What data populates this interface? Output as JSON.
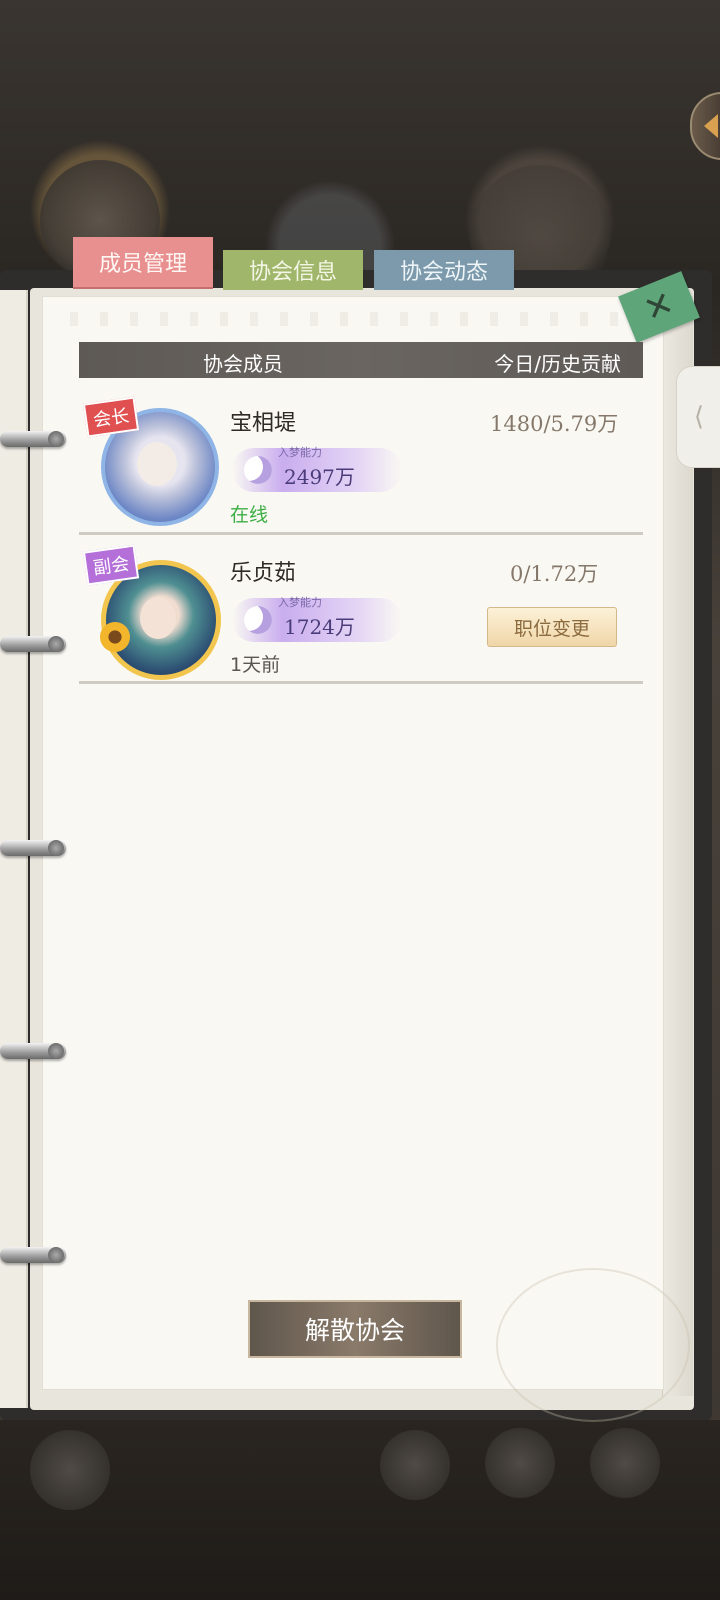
{
  "tabs": [
    {
      "label": "成员管理"
    },
    {
      "label": "协会信息"
    },
    {
      "label": "协会动态"
    }
  ],
  "header": {
    "members_label": "协会成员",
    "contribution_label": "今日/历史贡献"
  },
  "members": [
    {
      "rank_badge": "会长",
      "name": "宝相堤",
      "power_title": "入梦能力",
      "power_value": "2497万",
      "status": "在线",
      "contribution": "1480/5.79万"
    },
    {
      "rank_badge": "副会",
      "name": "乐贞茹",
      "power_title": "入梦能力",
      "power_value": "1724万",
      "status": "1天前",
      "contribution": "0/1.72万",
      "action_label": "职位变更"
    }
  ],
  "footer": {
    "disband_label": "解散协会"
  },
  "icons": {
    "close": "close-icon",
    "right_tab": "chevron-left-icon",
    "side_tab": "arrow-left-icon"
  },
  "colors": {
    "tab_members": "#e89090",
    "tab_info": "#a0b66a",
    "tab_news": "#7c9aab",
    "online": "#3dae44",
    "close_bg": "#5fa57a"
  }
}
